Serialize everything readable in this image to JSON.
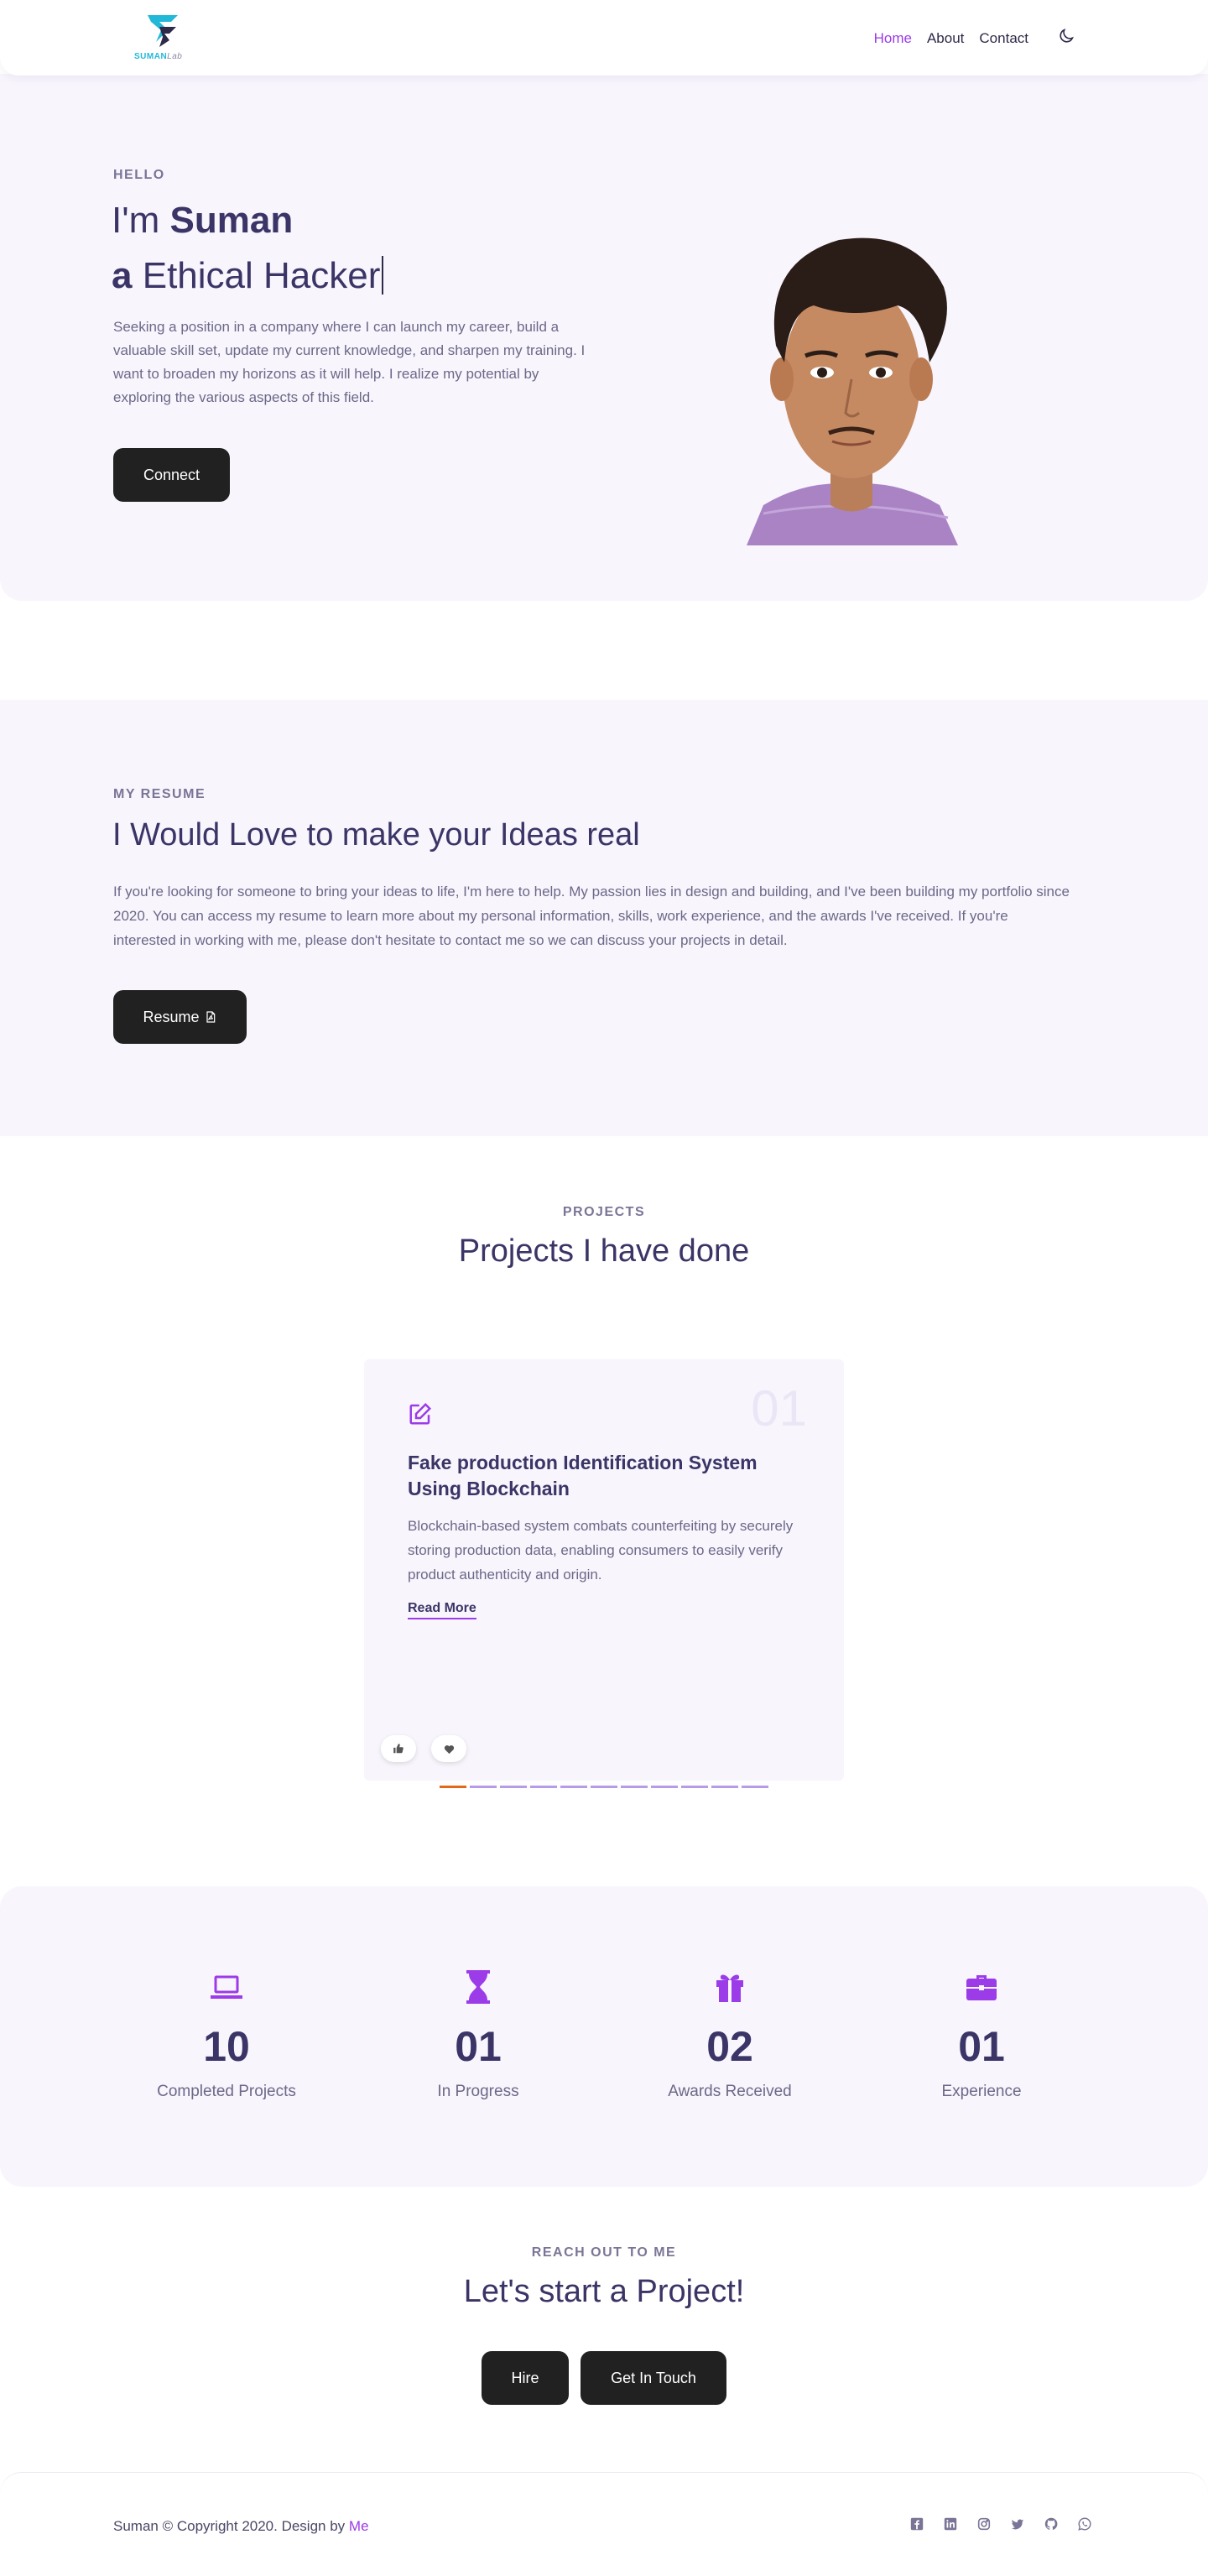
{
  "nav": {
    "logo_text": "SUMAN",
    "logo_sub": "Lab",
    "links": [
      "Home",
      "About",
      "Contact"
    ],
    "theme_icon": "moon-icon"
  },
  "hero": {
    "kicker": "HELLO",
    "greeting_prefix": "I'm",
    "name": "Suman",
    "role_prefix": "a",
    "role": "Ethical Hacker",
    "bio": "Seeking a position in a company where I can launch my career, build a valuable skill set, update my current knowledge, and sharpen my training. I want to broaden my horizons as it will help. I realize my potential by exploring the various aspects of this field.",
    "cta": "Connect"
  },
  "resume": {
    "kicker": "MY RESUME",
    "title": "I Would Love to make your Ideas real",
    "text": "If you're looking for someone to bring your ideas to life, I'm here to help. My passion lies in design and building, and I've been building my portfolio since 2020. You can access my resume to learn more about my personal information, skills, work experience, and the awards I've received. If you're interested in working with me, please don't hesitate to contact me so we can discuss your projects in detail.",
    "button": "Resume"
  },
  "projects": {
    "kicker": "PROJECTS",
    "title": "Projects I have done",
    "card": {
      "number": "01",
      "title": "Fake production Identification System Using Blockchain",
      "desc": "Blockchain-based system combats counterfeiting by securely storing production data, enabling consumers to easily verify product authenticity and origin.",
      "link": "Read More"
    },
    "slides_total": 11,
    "active_slide": 1
  },
  "stats": [
    {
      "icon": "laptop-icon",
      "value": "10",
      "label": "Completed Projects"
    },
    {
      "icon": "hourglass-icon",
      "value": "01",
      "label": "In Progress"
    },
    {
      "icon": "gift-icon",
      "value": "02",
      "label": "Awards Received"
    },
    {
      "icon": "briefcase-icon",
      "value": "01",
      "label": "Experience"
    }
  ],
  "contact": {
    "kicker": "REACH OUT TO ME",
    "title": "Let's start a Project!",
    "hire": "Hire",
    "touch": "Get In Touch"
  },
  "footer": {
    "copy": "Suman © Copyright 2020. Design by",
    "link": "Me",
    "socials": [
      "facebook-icon",
      "linkedin-icon",
      "instagram-icon",
      "twitter-icon",
      "github-icon",
      "whatsapp-icon"
    ]
  },
  "colors": {
    "accent": "#9b3ce8",
    "section_bg": "#f8f5fd",
    "heading": "#3a3566",
    "button": "#212121",
    "active_dot": "#e0691b"
  }
}
